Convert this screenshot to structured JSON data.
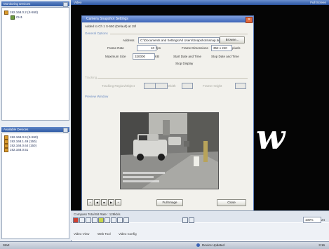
{
  "app": {
    "left_top_pane_title": "Monitoring Devices",
    "left_bottom_pane_title": "Available Devices",
    "video_title": "Video",
    "video_title_right": "Full Screen",
    "overlay_letter": "w"
  },
  "tree": {
    "root": "192.168.0.2 (S-550)",
    "child": "CH1"
  },
  "device_list": [
    "192.168.0.9 (S-550)",
    "192.168.1.49 (150)",
    "192.168.0.64 (150)",
    "192.168.0.51"
  ],
  "dialog": {
    "title": "Camera Snapshot Settings",
    "subtitle": "Added to Ch 1  S-550 (Default) at 15f",
    "section_general": "General Options",
    "address_label": "Address",
    "address_value": "C:\\Documents and Settings\\All Users\\Snapshots\\snap.bmp",
    "browse_label": "Browse...",
    "frame_rate_label": "Frame Rate",
    "frame_rate_value": "10",
    "frame_rate_unit": "fps",
    "frame_dims_label": "Frame Dimensions",
    "frame_dims_value": "352 x 240",
    "frame_dims_unit": "pixels",
    "maxsize_label": "Maximum Size",
    "maxsize_value": "320000",
    "maxsize_unit": "KB",
    "start_time_label": "Start Date and Time",
    "stop_time_label": "Stop Date and Time",
    "stop_display_label": "Stop Display",
    "section_tracking": "Tracking",
    "tracking_label": "Tracking Region/Object",
    "width_label": "Width",
    "height_label": "Frame Height",
    "preview_label": "Preview Window",
    "full_image_label": "Full Image",
    "close_label": "Close"
  },
  "playback": {
    "buttons": [
      "+",
      "◀",
      "■",
      "▶",
      "+"
    ]
  },
  "toolbar": {
    "status_text": "Compass  Total Bit Rate : 128kb/s",
    "zoom_value": "100%",
    "zoom_step": "24"
  },
  "taskbar": {
    "start_label": "Start",
    "tabs": [
      "Video View",
      "Web Tool",
      "Video Config"
    ],
    "notice": "Device Updated",
    "clock": "3:16"
  },
  "colors": {
    "title_bar": "#3a63b6",
    "dialog_bg": "#f2f1ec",
    "video_bg": "#050505",
    "close_button": "#e06a3c"
  }
}
